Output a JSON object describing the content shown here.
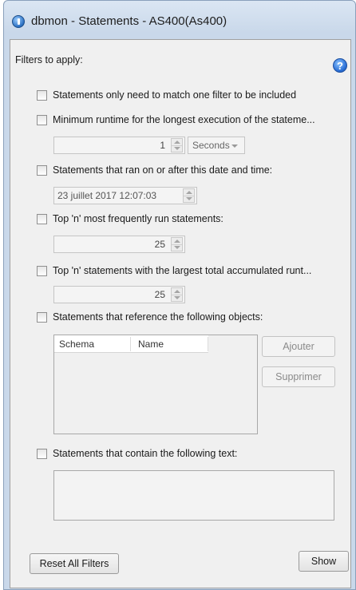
{
  "window": {
    "title": "dbmon - Statements - AS400(As400)"
  },
  "panel": {
    "header": "Filters to apply:"
  },
  "filters": {
    "match_one": "Statements only need to match one filter to be included",
    "min_runtime": "Minimum runtime for the longest execution of the stateme...",
    "min_runtime_value": "1",
    "min_runtime_unit": "Seconds",
    "date_time": "Statements that ran on or after this date and time:",
    "date_time_value": "23 juillet 2017 12:07:03",
    "top_frequent": "Top 'n' most frequently run statements:",
    "top_frequent_value": "25",
    "top_runtime": "Top 'n' statements with the largest total accumulated runt...",
    "top_runtime_value": "25",
    "objects": "Statements that reference the following objects:",
    "objects_columns": [
      "Schema",
      "Name"
    ],
    "add_label": "Ajouter",
    "remove_label": "Supprimer",
    "text": "Statements that contain the following text:"
  },
  "footer": {
    "reset_label": "Reset All Filters",
    "show_label": "Show"
  },
  "icons": {
    "app": "dbmon-app-icon",
    "help": "help-icon"
  }
}
